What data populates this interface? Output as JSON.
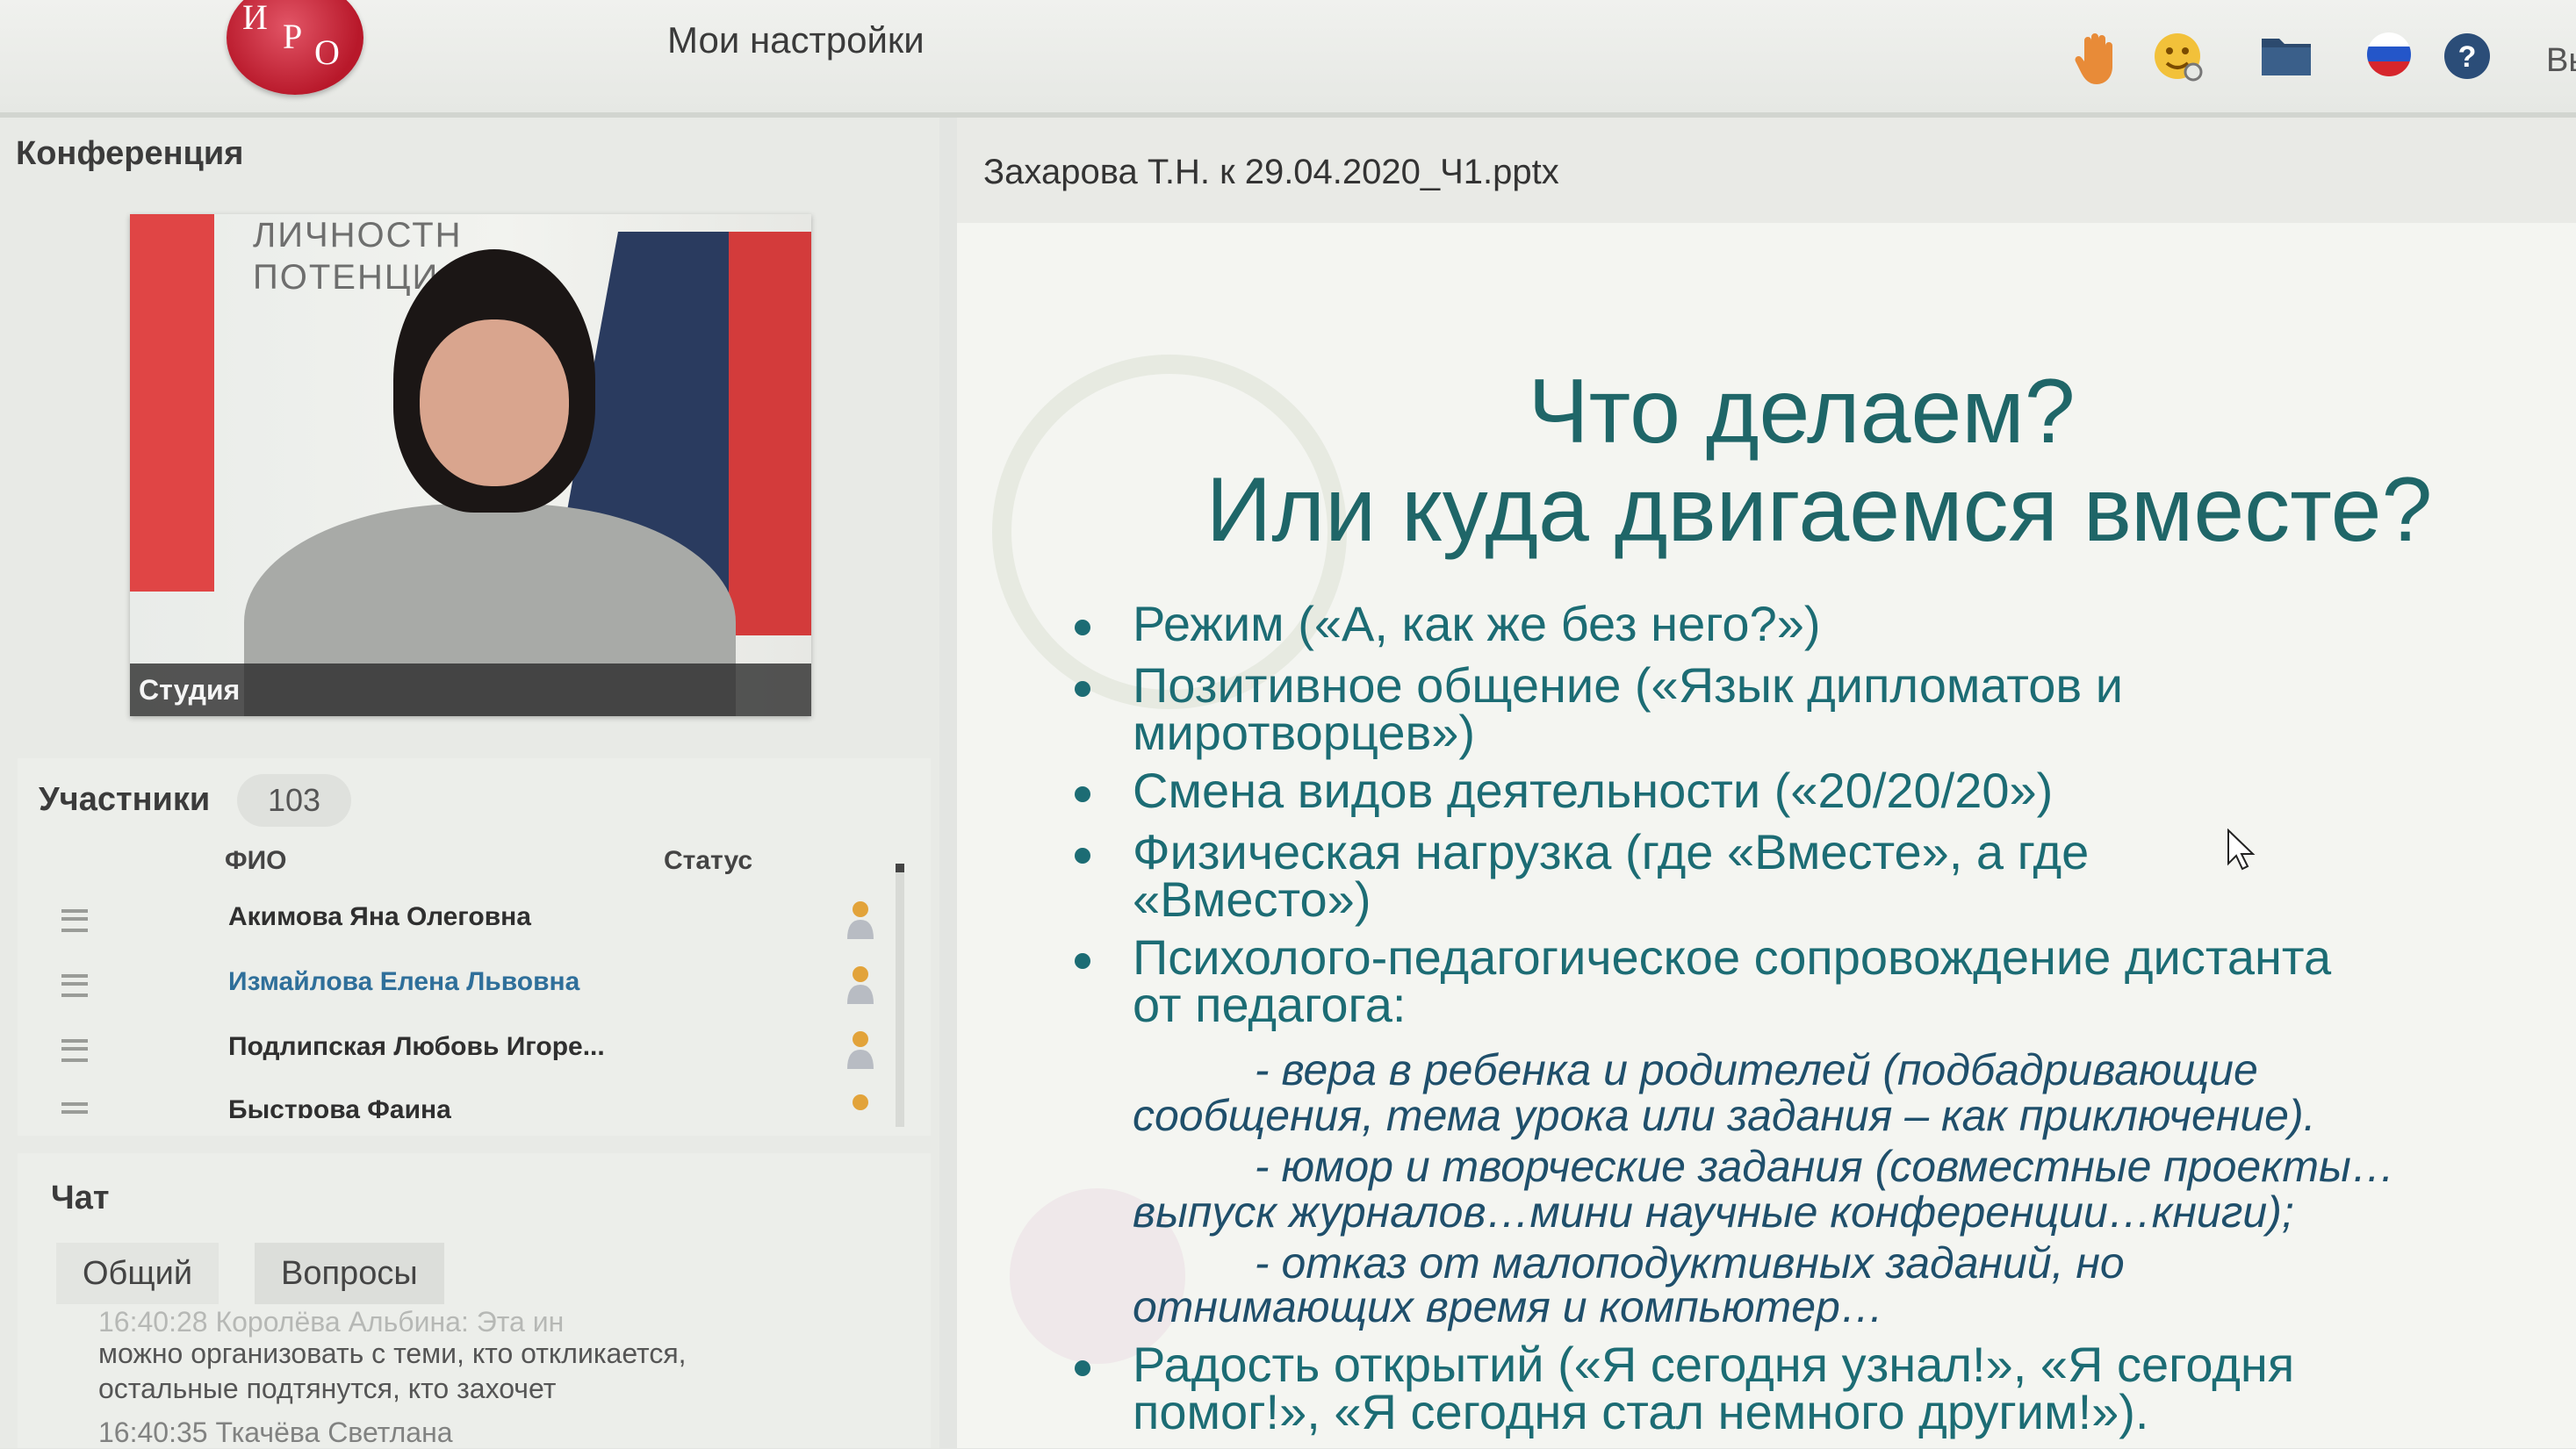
{
  "header": {
    "logo_letters": [
      "И",
      "Р",
      "О"
    ],
    "settings_label": "Мои настройки",
    "exit_label": "Вы",
    "icons": [
      "raise-hand-icon",
      "emoji-icon",
      "folder-icon",
      "russian-flag-icon",
      "help-icon"
    ]
  },
  "conference": {
    "title": "Конференция",
    "video_caption": "Студия",
    "background_sign": [
      "ЛИЧНОСТН",
      "ПОТЕНЦИ"
    ]
  },
  "participants": {
    "title": "Участники",
    "count": "103",
    "columns": [
      "ФИО",
      "Статус"
    ],
    "rows": [
      {
        "name": "Акимова  Яна  Олеговна",
        "highlight": false
      },
      {
        "name": "Измайлова Елена  Львовна",
        "highlight": true
      },
      {
        "name": "Подлипская Любовь  Игоре...",
        "highlight": false
      },
      {
        "name": "Быстрова Фаина",
        "highlight": false
      }
    ]
  },
  "chat": {
    "title": "Чат",
    "tabs": [
      "Общий",
      "Вопросы"
    ],
    "messages": [
      "16:40:28 Королёва Альбина: Эта ин",
      "можно организовать с теми, кто откликается,",
      "остальные подтянутся, кто захочет",
      "16:40:35 Ткачёва Светлана"
    ]
  },
  "presentation": {
    "file_name": "Захарова Т.Н. к 29.04.2020_Ч1.pptx",
    "heading_line1": "Что делаем?",
    "heading_line2": "Или куда двигаемся вместе?",
    "bullets": [
      "Режим («А, как же без него?»)",
      "Позитивное общение («Язык дипломатов и",
      "миротворцев»)",
      "Смена видов деятельности («20/20/20»)",
      "Физическая нагрузка  (где «Вместе», а где",
      "«Вместо»)",
      "Психолого-педагогическое сопровождение дистанта",
      "от педагога:"
    ],
    "sub_items": [
      "          - вера в ребенка и родителей (подбадривающие",
      "сообщения, тема урока или задания – как приключение).",
      "          - юмор и творческие задания (совместные проекты…",
      "выпуск журналов…мини научные конференции…книги);",
      "          - отказ от малоподуктивных заданий, но",
      "отнимающих время и компьютер…"
    ],
    "last_bullet": [
      "Радость открытий («Я сегодня узнал!», «Я сегодня",
      "помог!», «Я сегодня стал немного другим!»)."
    ]
  },
  "colors": {
    "slide_text": "#1c6c74",
    "logo_red": "#c0202f",
    "highlight_name": "#2f6f9a"
  }
}
